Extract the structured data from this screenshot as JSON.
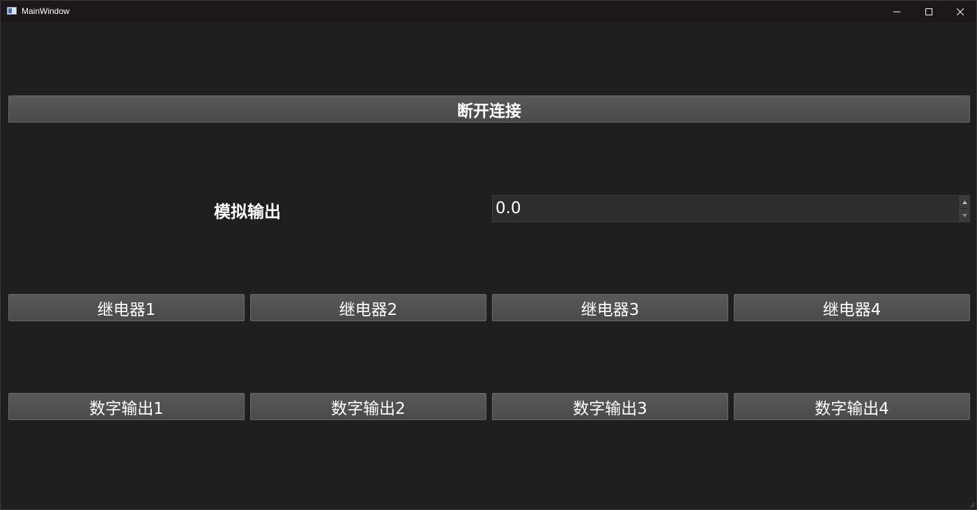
{
  "window": {
    "title": "MainWindow"
  },
  "controls": {
    "disconnect_label": "断开连接",
    "analog_output_label": "模拟输出",
    "analog_output_value": "0.0",
    "relays": [
      "继电器1",
      "继电器2",
      "继电器3",
      "继电器4"
    ],
    "digital_outputs": [
      "数字输出1",
      "数字输出2",
      "数字输出3",
      "数字输出4"
    ]
  },
  "icons": {
    "app": "app-window-icon",
    "minimize": "minimize-icon",
    "maximize": "maximize-icon",
    "close": "close-icon",
    "spin_up": "spin-up-arrow-icon",
    "spin_down": "spin-down-arrow-icon",
    "resize": "resize-grip-icon"
  },
  "colors": {
    "background": "#1f1f1f",
    "titlebar": "#1b171a",
    "button": "#4f4f4f",
    "text": "#ffffff"
  }
}
